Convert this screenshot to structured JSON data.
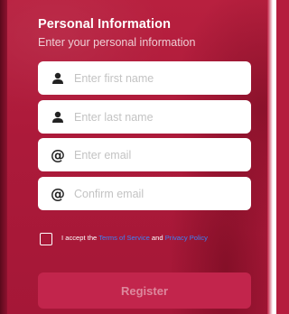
{
  "header": {
    "title": "Personal Information",
    "subtitle": "Enter your personal information"
  },
  "fields": [
    {
      "icon": "user-icon",
      "placeholder": "Enter first name",
      "value": ""
    },
    {
      "icon": "user-icon",
      "placeholder": "Enter last name",
      "value": ""
    },
    {
      "icon": "at-icon",
      "placeholder": "Enter email",
      "value": ""
    },
    {
      "icon": "at-icon",
      "placeholder": "Confirm email",
      "value": ""
    }
  ],
  "icons": {
    "at_glyph": "@"
  },
  "terms": {
    "checked": false,
    "prefix": "I accept the",
    "terms_link": "Terms of Service",
    "and": "and",
    "privacy_link": "Privacy Policy"
  },
  "register": {
    "label": "Register",
    "enabled": false
  },
  "colors": {
    "background": "#b51d3e",
    "button": "#c2254c",
    "link": "#3b82f6",
    "field": "#ffffff"
  }
}
